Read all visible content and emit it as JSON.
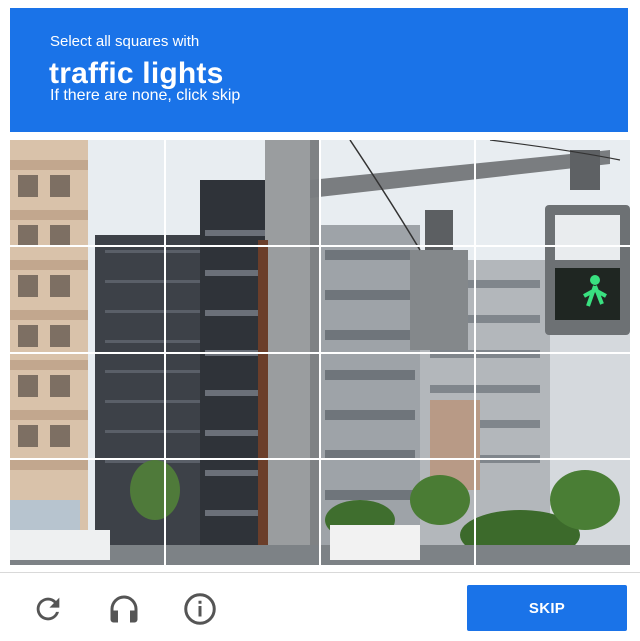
{
  "header": {
    "instruction": "Select all squares with",
    "target": "traffic lights",
    "hint": "If there are none, click skip"
  },
  "grid": {
    "rows": 4,
    "cols": 4,
    "tiles": [
      {
        "row": 1,
        "col": 1
      },
      {
        "row": 1,
        "col": 2
      },
      {
        "row": 1,
        "col": 3
      },
      {
        "row": 1,
        "col": 4
      },
      {
        "row": 2,
        "col": 1
      },
      {
        "row": 2,
        "col": 2
      },
      {
        "row": 2,
        "col": 3
      },
      {
        "row": 2,
        "col": 4
      },
      {
        "row": 3,
        "col": 1
      },
      {
        "row": 3,
        "col": 2
      },
      {
        "row": 3,
        "col": 3
      },
      {
        "row": 3,
        "col": 4
      },
      {
        "row": 4,
        "col": 1
      },
      {
        "row": 4,
        "col": 2
      },
      {
        "row": 4,
        "col": 3
      },
      {
        "row": 4,
        "col": 4
      }
    ]
  },
  "footer": {
    "icons": [
      "reload-icon",
      "audio-headphones-icon",
      "info-icon"
    ],
    "skip_label": "SKIP"
  },
  "colors": {
    "accent": "#1a73e8",
    "header_text": "#ffffff",
    "icon": "#555555"
  }
}
